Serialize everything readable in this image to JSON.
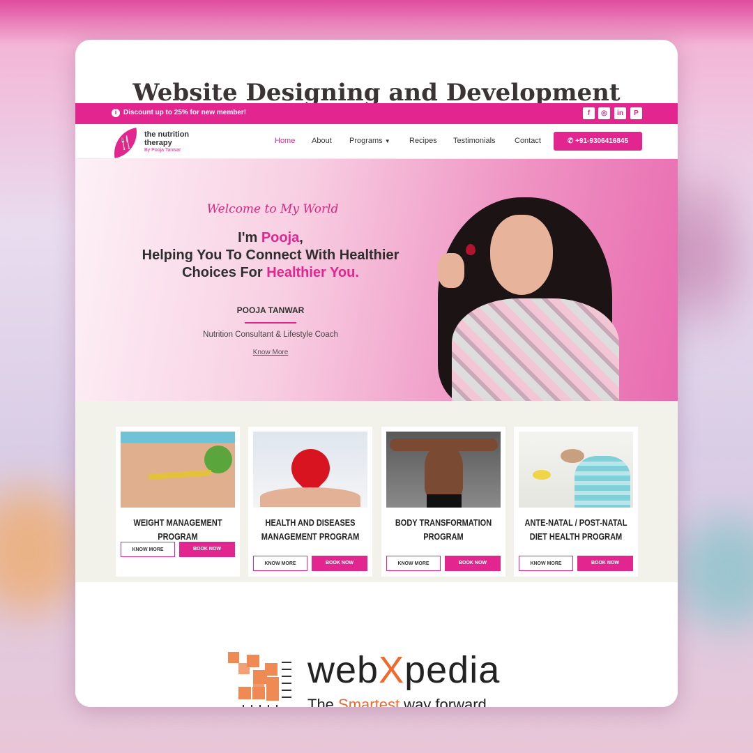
{
  "card_title": "Website Designing and Development",
  "site": {
    "topbar": {
      "promo": "Discount up to 25% for new member!",
      "social": [
        {
          "icon": "facebook-icon",
          "glyph": "f"
        },
        {
          "icon": "instagram-icon",
          "glyph": "◎"
        },
        {
          "icon": "linkedin-icon",
          "glyph": "in"
        },
        {
          "icon": "pinterest-icon",
          "glyph": "P"
        }
      ]
    },
    "logo": {
      "line1": "the nutrition",
      "line2": "therapy",
      "line3": "By Pooja Tanwar"
    },
    "nav": {
      "home": "Home",
      "about": "About",
      "programs": "Programs",
      "recipes": "Recipes",
      "testimonials": "Testimonials",
      "contact": "Contact",
      "phone": "+91-9306416845"
    },
    "hero": {
      "welcome": "Welcome to My World",
      "line1_pre": "I'm ",
      "line1_name": "Pooja",
      "line1_post": ",",
      "line2": "Helping You To Connect With Healthier",
      "line3_pre": "Choices For ",
      "line3_pink": "Healthier You.",
      "name": "POOJA TANWAR",
      "role": "Nutrition Consultant & Lifestyle Coach",
      "know_more": "Know More"
    },
    "programs": [
      {
        "title": "WEIGHT MANAGEMENT PROGRAM",
        "know": "KNOW MORE",
        "book": "BOOK NOW"
      },
      {
        "title": "HEALTH AND DISEASES MANAGEMENT PROGRAM",
        "know": "KNOW MORE",
        "book": "BOOK NOW"
      },
      {
        "title": "BODY TRANSFORMATION PROGRAM",
        "know": "KNOW MORE",
        "book": "BOOK NOW"
      },
      {
        "title": "ANTE-NATAL / POST-NATAL DIET HEALTH PROGRAM",
        "know": "KNOW MORE",
        "book": "BOOK NOW"
      }
    ]
  },
  "brand": {
    "name_pre": "web",
    "name_x": "X",
    "name_post": "pedia",
    "tag_pre": "The ",
    "tag_smart": "Smartest",
    "tag_post": " way forward"
  },
  "colors": {
    "accent": "#e3268f",
    "brand_orange": "#ef6a2e"
  }
}
